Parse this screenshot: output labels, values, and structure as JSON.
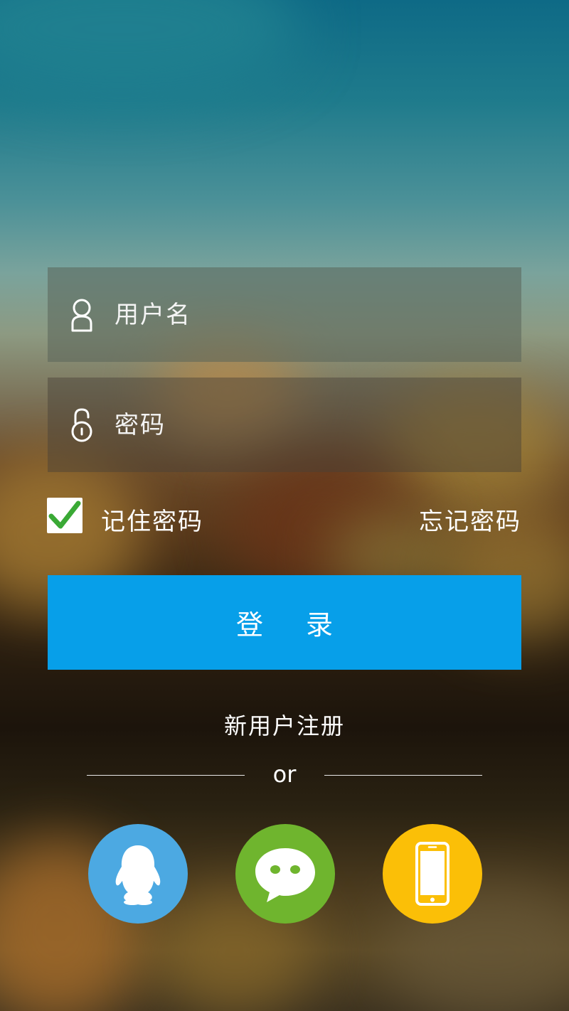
{
  "login_form": {
    "username_placeholder": "用户名",
    "password_placeholder": "密码",
    "remember_label": "记住密码",
    "remember_checked": true,
    "forgot_label": "忘记密码",
    "login_label": "登 录"
  },
  "register": {
    "label": "新用户注册"
  },
  "divider": {
    "label": "or"
  },
  "social_login": [
    {
      "name": "qq",
      "icon": "qq-penguin-icon",
      "color": "#4ca9e2"
    },
    {
      "name": "wechat",
      "icon": "wechat-chat-bubbles-icon",
      "color": "#6fb52e"
    },
    {
      "name": "phone",
      "icon": "mobile-phone-icon",
      "color": "#fbbf07"
    }
  ],
  "colors": {
    "login_button": "#079fe9",
    "checkmark": "#3aa935"
  }
}
